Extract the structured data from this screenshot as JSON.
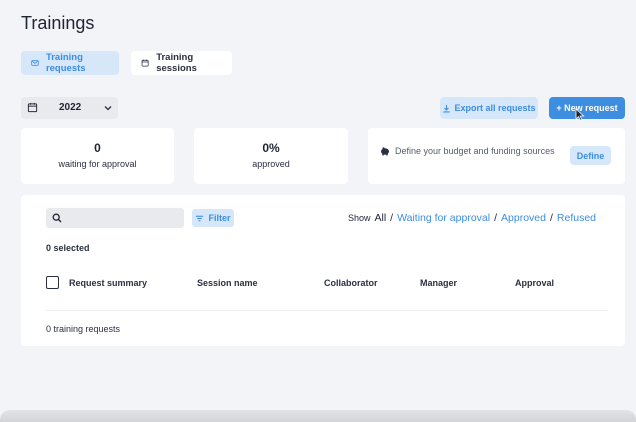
{
  "page": {
    "title": "Trainings"
  },
  "tabs": [
    {
      "label": "Training requests",
      "icon": "mail-icon",
      "active": true
    },
    {
      "label": "Training sessions",
      "icon": "calendar-icon",
      "active": false
    }
  ],
  "year_select": {
    "value": "2022",
    "icon": "calendar-icon"
  },
  "actions": {
    "export_label": "Export all requests",
    "new_request_label": "+ New request"
  },
  "stats": [
    {
      "value": "0",
      "label": "waiting for approval"
    },
    {
      "value": "0%",
      "label": "approved"
    }
  ],
  "budget": {
    "text": "Define your budget and funding sources",
    "button_label": "Define"
  },
  "list": {
    "search_placeholder": "",
    "filter_label": "Filter",
    "show_label": "Show",
    "filters": [
      "All",
      "Waiting for approval",
      "Approved",
      "Refused"
    ],
    "active_filter": "All",
    "selected_text": "0 selected",
    "columns": [
      "Request summary",
      "Session name",
      "Collaborator",
      "Manager",
      "Approval"
    ],
    "count_text": "0 training requests"
  },
  "colors": {
    "accent": "#3d8de0",
    "accent_light": "#d7e7fa",
    "background": "#f3f4f8"
  }
}
